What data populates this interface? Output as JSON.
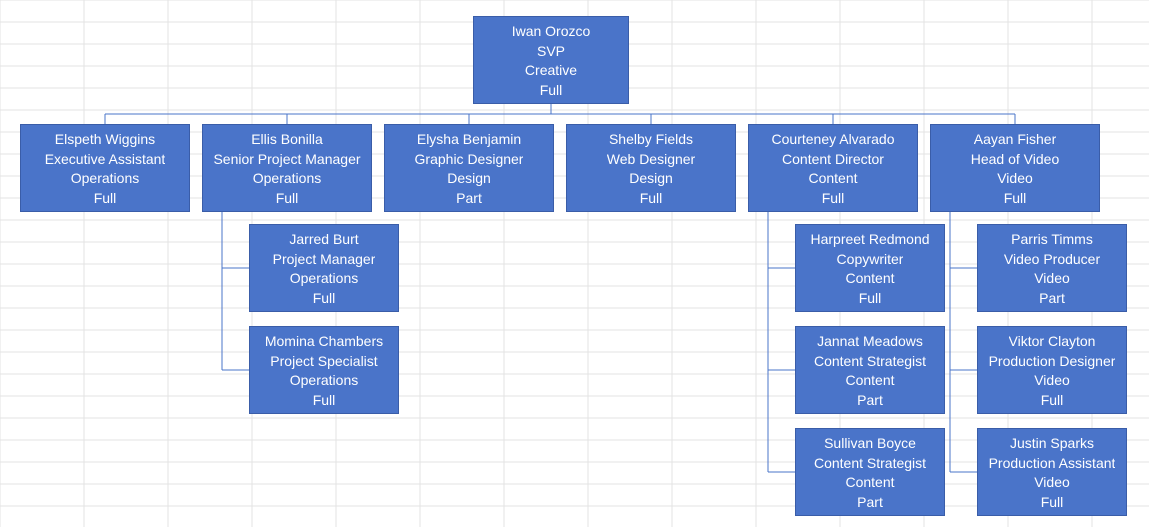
{
  "chart_data": {
    "type": "org-chart",
    "root": {
      "name": "Iwan Orozco",
      "title": "SVP",
      "dept": "Creative",
      "status": "Full",
      "children": [
        {
          "name": "Elspeth Wiggins",
          "title": "Executive Assistant",
          "dept": "Operations",
          "status": "Full",
          "children": []
        },
        {
          "name": "Ellis Bonilla",
          "title": "Senior Project Manager",
          "dept": "Operations",
          "status": "Full",
          "children": [
            {
              "name": "Jarred Burt",
              "title": "Project Manager",
              "dept": "Operations",
              "status": "Full",
              "children": []
            },
            {
              "name": "Momina Chambers",
              "title": "Project Specialist",
              "dept": "Operations",
              "status": "Full",
              "children": []
            }
          ]
        },
        {
          "name": "Elysha Benjamin",
          "title": "Graphic Designer",
          "dept": "Design",
          "status": "Part",
          "children": []
        },
        {
          "name": "Shelby Fields",
          "title": "Web Designer",
          "dept": "Design",
          "status": "Full",
          "children": []
        },
        {
          "name": "Courteney Alvarado",
          "title": "Content Director",
          "dept": "Content",
          "status": "Full",
          "children": [
            {
              "name": "Harpreet Redmond",
              "title": "Copywriter",
              "dept": "Content",
              "status": "Full",
              "children": []
            },
            {
              "name": "Jannat Meadows",
              "title": "Content Strategist",
              "dept": "Content",
              "status": "Part",
              "children": []
            },
            {
              "name": "Sullivan Boyce",
              "title": "Content Strategist",
              "dept": "Content",
              "status": "Part",
              "children": []
            }
          ]
        },
        {
          "name": "Aayan Fisher",
          "title": "Head of Video",
          "dept": "Video",
          "status": "Full",
          "children": [
            {
              "name": "Parris Timms",
              "title": "Video Producer",
              "dept": "Video",
              "status": "Part",
              "children": []
            },
            {
              "name": "Viktor Clayton",
              "title": "Production Designer",
              "dept": "Video",
              "status": "Full",
              "children": []
            },
            {
              "name": "Justin Sparks",
              "title": "Production Assistant",
              "dept": "Video",
              "status": "Full",
              "children": []
            }
          ]
        }
      ]
    }
  },
  "nodes": {
    "root": {
      "name": "Iwan Orozco",
      "title": "SVP",
      "dept": "Creative",
      "status": "Full"
    },
    "c0": {
      "name": "Elspeth Wiggins",
      "title": "Executive Assistant",
      "dept": "Operations",
      "status": "Full"
    },
    "c1": {
      "name": "Ellis Bonilla",
      "title": "Senior Project Manager",
      "dept": "Operations",
      "status": "Full"
    },
    "c2": {
      "name": "Elysha Benjamin",
      "title": "Graphic Designer",
      "dept": "Design",
      "status": "Part"
    },
    "c3": {
      "name": "Shelby Fields",
      "title": "Web Designer",
      "dept": "Design",
      "status": "Full"
    },
    "c4": {
      "name": "Courteney Alvarado",
      "title": "Content Director",
      "dept": "Content",
      "status": "Full"
    },
    "c5": {
      "name": "Aayan Fisher",
      "title": "Head of Video",
      "dept": "Video",
      "status": "Full"
    },
    "c1_0": {
      "name": "Jarred Burt",
      "title": "Project Manager",
      "dept": "Operations",
      "status": "Full"
    },
    "c1_1": {
      "name": "Momina Chambers",
      "title": "Project Specialist",
      "dept": "Operations",
      "status": "Full"
    },
    "c4_0": {
      "name": "Harpreet Redmond",
      "title": "Copywriter",
      "dept": "Content",
      "status": "Full"
    },
    "c4_1": {
      "name": "Jannat Meadows",
      "title": "Content Strategist",
      "dept": "Content",
      "status": "Part"
    },
    "c4_2": {
      "name": "Sullivan Boyce",
      "title": "Content Strategist",
      "dept": "Content",
      "status": "Part"
    },
    "c5_0": {
      "name": "Parris Timms",
      "title": "Video Producer",
      "dept": "Video",
      "status": "Part"
    },
    "c5_1": {
      "name": "Viktor Clayton",
      "title": "Production Designer",
      "dept": "Video",
      "status": "Full"
    },
    "c5_2": {
      "name": "Justin Sparks",
      "title": "Production Assistant",
      "dept": "Video",
      "status": "Full"
    }
  }
}
